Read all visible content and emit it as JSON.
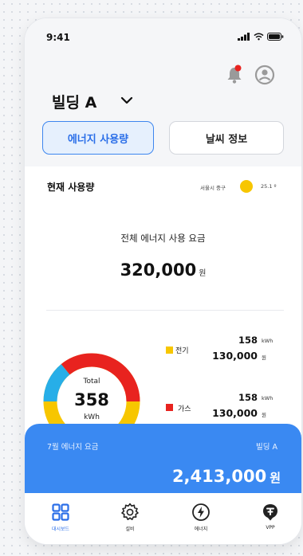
{
  "status_bar": {
    "time": "9:41"
  },
  "header": {
    "building": "빌딩 A"
  },
  "tabs": [
    {
      "label": "에너지 사용량",
      "active": true
    },
    {
      "label": "날씨 정보",
      "active": false
    }
  ],
  "current_usage": {
    "title": "현재 사용량",
    "location": "서울시 중구",
    "temperature": "25.1 º",
    "total_label": "전체 에너지 사용 요금",
    "total_amount": "320,000",
    "total_unit": "원"
  },
  "donut": {
    "total_label": "Total",
    "total_value": "358",
    "unit": "kWh",
    "colors": {
      "electricity": "#f7c600",
      "gas": "#e8231f",
      "other": "#27aee8"
    }
  },
  "legend": [
    {
      "label": "전기",
      "color": "#f7c600",
      "kwh": "158",
      "kwh_unit": "kWh",
      "won": "130,000",
      "won_unit": "원"
    },
    {
      "label": "가스",
      "color": "#e8231f",
      "kwh": "158",
      "kwh_unit": "kWh",
      "won": "130,000",
      "won_unit": "원"
    }
  ],
  "bill": {
    "title": "7월 에너지 요금",
    "building": "빌딩 A",
    "amount": "2,413,000",
    "unit": "원"
  },
  "tabbar": [
    {
      "label": "대시보드",
      "icon": "grid-icon",
      "active": true
    },
    {
      "label": "설비",
      "icon": "gear-icon",
      "active": false
    },
    {
      "label": "에너지",
      "icon": "bolt-icon",
      "active": false
    },
    {
      "label": "VPP",
      "icon": "vpp-icon",
      "active": false
    }
  ]
}
